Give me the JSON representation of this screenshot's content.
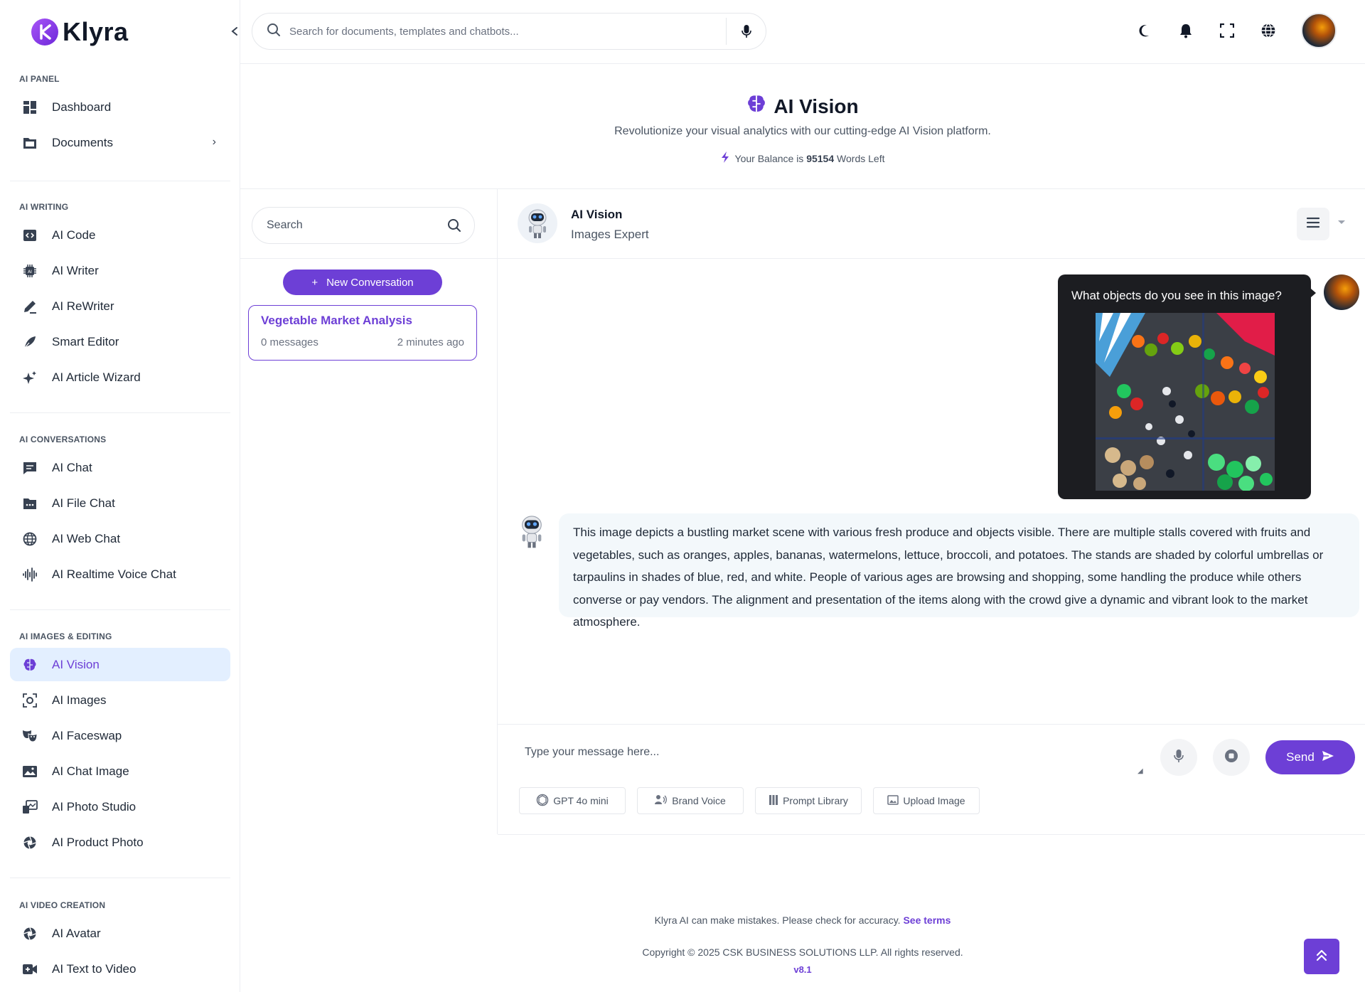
{
  "brand": {
    "name": "Klyra",
    "logo_letter": "K",
    "accent": "#6d3fd6"
  },
  "topbar": {
    "search_placeholder": "Search for documents, templates and chatbots...",
    "icons": [
      "moon-icon",
      "bell-icon",
      "fullscreen-icon",
      "globe-icon"
    ]
  },
  "sidebar": {
    "sections": [
      {
        "title": "AI PANEL",
        "items": [
          {
            "label": "Dashboard",
            "icon": "dashboard-icon"
          },
          {
            "label": "Documents",
            "icon": "folder-icon",
            "has_children": true
          }
        ]
      },
      {
        "title": "AI WRITING",
        "items": [
          {
            "label": "AI Code",
            "icon": "code-icon"
          },
          {
            "label": "AI Writer",
            "icon": "chip-icon"
          },
          {
            "label": "AI ReWriter",
            "icon": "pen-icon"
          },
          {
            "label": "Smart Editor",
            "icon": "feather-icon"
          },
          {
            "label": "AI Article Wizard",
            "icon": "sparkle-icon"
          }
        ]
      },
      {
        "title": "AI CONVERSATIONS",
        "items": [
          {
            "label": "AI Chat",
            "icon": "chat-icon"
          },
          {
            "label": "AI File Chat",
            "icon": "file-chat-icon"
          },
          {
            "label": "AI Web Chat",
            "icon": "globe-icon"
          },
          {
            "label": "AI Realtime Voice Chat",
            "icon": "waveform-icon"
          }
        ]
      },
      {
        "title": "AI IMAGES & EDITING",
        "items": [
          {
            "label": "AI Vision",
            "icon": "brain-icon",
            "active": true
          },
          {
            "label": "AI Images",
            "icon": "camera-scan-icon"
          },
          {
            "label": "AI Faceswap",
            "icon": "masks-icon"
          },
          {
            "label": "AI Chat Image",
            "icon": "image-icon"
          },
          {
            "label": "AI Photo Studio",
            "icon": "photo-studio-icon"
          },
          {
            "label": "AI Product Photo",
            "icon": "aperture-icon"
          }
        ]
      },
      {
        "title": "AI VIDEO CREATION",
        "items": [
          {
            "label": "AI Avatar",
            "icon": "aperture-icon"
          },
          {
            "label": "AI Text to Video",
            "icon": "video-plus-icon"
          }
        ]
      }
    ]
  },
  "header": {
    "title": "AI Vision",
    "subtitle": "Revolutionize your visual analytics with our cutting-edge AI Vision platform.",
    "balance_prefix": "Your Balance is",
    "balance_value": "95154",
    "balance_suffix": "Words Left"
  },
  "conversations": {
    "search_placeholder": "Search",
    "new_button": "New Conversation",
    "items": [
      {
        "title": "Vegetable Market Analysis",
        "messages": "0 messages",
        "time": "2 minutes ago"
      }
    ]
  },
  "chat": {
    "bot_name": "AI Vision",
    "bot_role": "Images Expert",
    "user_question": "What objects do you see in this image?",
    "bot_reply": "This image depicts a bustling market scene with various fresh produce and objects visible. There are multiple stalls covered with fruits and vegetables, such as oranges, apples, bananas, watermelons, lettuce, broccoli, and potatoes. The stands are shaded by colorful umbrellas or tarpaulins in shades of blue, red, and white. People of various ages are browsing and shopping, some handling the produce while others converse or pay vendors. The alignment and presentation of the items along with the crowd give a dynamic and vibrant look to the market atmosphere.",
    "input_placeholder": "Type your message here...",
    "send_label": "Send",
    "tools": [
      {
        "label": "GPT 4o mini",
        "icon": "openai-icon"
      },
      {
        "label": "Brand Voice",
        "icon": "voice-icon"
      },
      {
        "label": "Prompt Library",
        "icon": "library-icon"
      },
      {
        "label": "Upload Image",
        "icon": "upload-image-icon"
      }
    ]
  },
  "footer": {
    "disclaimer": "Klyra AI can make mistakes. Please check for accuracy.",
    "terms_link": "See terms",
    "copyright": "Copyright © 2025 CSK BUSINESS SOLUTIONS LLP. All rights reserved.",
    "version": "v8.1"
  }
}
